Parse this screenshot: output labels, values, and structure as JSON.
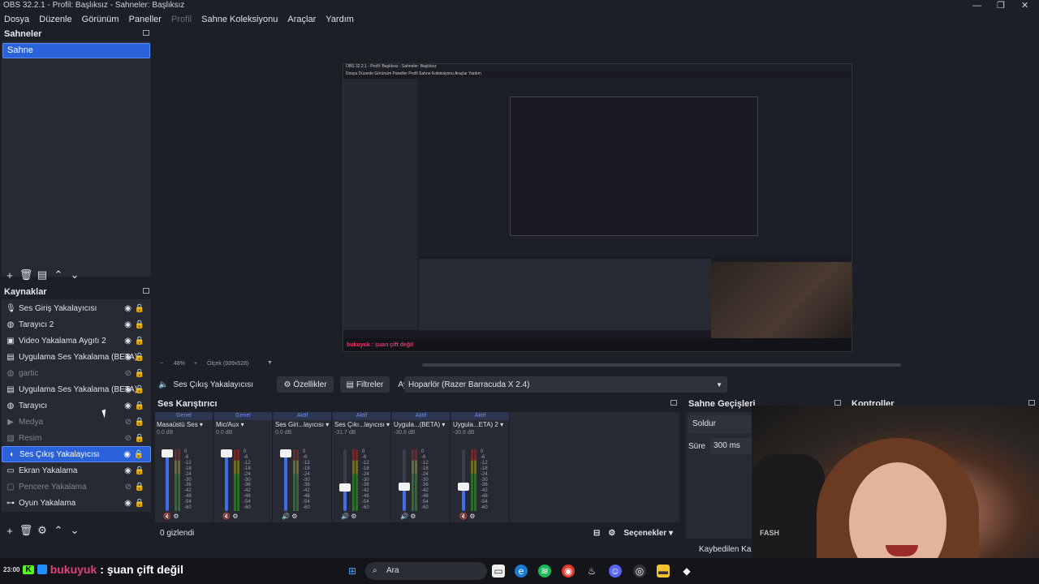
{
  "window": {
    "title": "OBS 32.2.1 - Profil: Başlıksız - Sahneler: Başlıksız"
  },
  "menu": [
    "Dosya",
    "Düzenle",
    "Görünüm",
    "Paneller",
    "Profil",
    "Sahne Koleksiyonu",
    "Araçlar",
    "Yardım"
  ],
  "scenes": {
    "title": "Sahneler",
    "items": [
      "Sahne"
    ]
  },
  "sources": {
    "title": "Kaynaklar",
    "items": [
      {
        "label": "Ses Giriş Yakalayıcısı",
        "icon": "mic-icon",
        "visible": true
      },
      {
        "label": "Tarayıcı 2",
        "icon": "globe-icon",
        "visible": true
      },
      {
        "label": "Video Yakalama Aygıtı 2",
        "icon": "camera-icon",
        "visible": true
      },
      {
        "label": "Uygulama Ses Yakalama (BETA)",
        "icon": "app-audio-icon",
        "visible": true
      },
      {
        "label": "gartic",
        "icon": "globe-icon",
        "visible": false
      },
      {
        "label": "Uygulama Ses Yakalama (BETA)",
        "icon": "app-audio-icon",
        "visible": true
      },
      {
        "label": "Tarayıcı",
        "icon": "globe-icon",
        "visible": true
      },
      {
        "label": "Medya",
        "icon": "play-icon",
        "visible": false
      },
      {
        "label": "Resim",
        "icon": "image-icon",
        "visible": false
      },
      {
        "label": "Ses Çıkış Yakalayıcısı",
        "icon": "speaker-icon",
        "visible": true
      },
      {
        "label": "Ekran Yakalama",
        "icon": "monitor-icon",
        "visible": true
      },
      {
        "label": "Pencere Yakalama",
        "icon": "window-icon",
        "visible": false
      },
      {
        "label": "Oyun Yakalama",
        "icon": "gamepad-icon",
        "visible": true
      }
    ]
  },
  "preview": {
    "zoom": "48%",
    "scale": "Ölçek (939x528)",
    "inner_title": "OBS 32.2.1 - Profil: Başlıksız - Sahneler: Başlıksız",
    "inner_menu": "Dosya  Düzenle  Görünüm  Paneller  Profil  Sahne Koleksiyonu  Araçlar  Yardım",
    "inner_chat": "bukuyuk : şuan çift değil"
  },
  "context": {
    "source_name": "Ses Çıkış Yakalayıcısı",
    "properties": "Özellikler",
    "filters": "Filtreler",
    "device_label": "Aygıt",
    "device_value": "Hoparlör (Razer Barracuda X 2.4)"
  },
  "mixer": {
    "title": "Ses Karıştırıcı",
    "hidden": "0 gizlendi",
    "options": "Seçenekler",
    "scale": [
      "0",
      "-6",
      "-12",
      "-18",
      "-24",
      "-30",
      "-36",
      "-42",
      "-48",
      "-54",
      "-60"
    ],
    "channels": [
      {
        "state": "Genel",
        "name": "Masaüstü Ses",
        "db": "0.0 dB",
        "level": 1.0,
        "muted": true
      },
      {
        "state": "Genel",
        "name": "Mic/Aux",
        "db": "0.0 dB",
        "level": 1.0,
        "muted": true
      },
      {
        "state": "Aktif",
        "name": "Ses Giri...layıcısı",
        "db": "0.0 dB",
        "level": 1.0,
        "muted": false
      },
      {
        "state": "Aktif",
        "name": "Ses Çıkı...layıcısı",
        "db": "-31.7 dB",
        "level": 0.36,
        "muted": false
      },
      {
        "state": "Aktif",
        "name": "Uygula...(BETA)",
        "db": "-30.8 dB",
        "level": 0.38,
        "muted": false
      },
      {
        "state": "Aktif",
        "name": "Uygula...ETA) 2",
        "db": "-30.8 dB",
        "level": 0.38,
        "muted": true
      }
    ]
  },
  "transitions": {
    "title": "Sahne Geçişleri",
    "type": "Soldur",
    "duration_label": "Süre",
    "duration": "300 ms"
  },
  "controls": {
    "title": "Kontroller"
  },
  "status": {
    "dropped": "Kaybedilen Karel"
  },
  "taskbar": {
    "time": "23:00",
    "chat_user": "bukuyuk",
    "chat_msg": ": şuan çift değil",
    "search": "Ara"
  },
  "webcam": {
    "chair_text": "FASH"
  }
}
